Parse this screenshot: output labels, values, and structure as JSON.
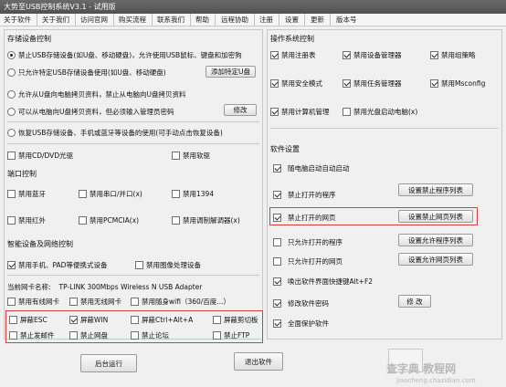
{
  "title": "大势至USB控制系统V3.1 - 试用版",
  "menu": [
    "关于软件",
    "关于我们",
    "访问官网",
    "购买流程",
    "联系我们",
    "帮助",
    "远程协助",
    "注册",
    "设置",
    "更新",
    "版本号"
  ],
  "storage": {
    "title": "存储设备控制",
    "opt1": "禁止USB存储设备(如U盘、移动硬盘)，允许使用USB鼠标、键盘和加密狗",
    "opt2": "只允许特定USB存储设备使用(如U盘、移动硬盘)",
    "add_btn": "添加特定U盘",
    "opt3": "允许从U盘向电脑拷贝资料，禁止从电脑向U盘拷贝资料",
    "opt4": "可以从电脑向U盘拷贝资料，但必须输入管理员密码",
    "modify_btn": "修改",
    "opt5": "恢复USB存储设备、手机或蓝牙等设备的使用(可手动点击恢复设备)",
    "cd": "禁用CD/DVD光驱",
    "floppy": "禁用软驱"
  },
  "ports": {
    "title": "端口控制",
    "bluetooth": "禁用蓝牙",
    "serial": "禁用串口/并口(x)",
    "p1394": "禁用1394",
    "infrared": "禁用红外",
    "pcmcia": "禁用PCMCIA(x)",
    "modem": "禁用调制解调器(x)"
  },
  "smart": {
    "title": "智能设备及网络控制",
    "phone": "禁用手机、PAD等便携式设备",
    "imaging": "禁用图像处理设备",
    "nic_label": "当前网卡名称:",
    "nic_value": "TP-LINK 300Mbps Wireless N USB Adapter",
    "wired": "禁用有线网卡",
    "wireless": "禁用无线网卡",
    "wifi": "禁用随身wifi（360/百度...）"
  },
  "keys": {
    "esc": "屏蔽ESC",
    "win": "屏蔽WIN",
    "ctrl_alt_a": "屏蔽Ctrl+Alt+A",
    "clipboard": "屏蔽剪切板",
    "email": "禁止发邮件",
    "netdisk": "禁止网盘",
    "forum": "禁止论坛",
    "ftp": "禁止FTP"
  },
  "os": {
    "title": "操作系统控制",
    "registry": "禁用注册表",
    "device_mgr": "禁用设备管理器",
    "gpedit": "禁用组策略",
    "safe_mode": "禁用安全模式",
    "task_mgr": "禁用任务管理器",
    "msconfig": "禁用Msconfig",
    "computer_mgmt": "禁用计算机管理",
    "cd_boot": "禁用光盘启动电脑(x)"
  },
  "software": {
    "title": "软件设置",
    "autostart": "随电脑启动自动启动",
    "block_programs": "禁止打开的程序",
    "block_programs_btn": "设置禁止程序列表",
    "block_sites": "禁止打开的网页",
    "block_sites_btn": "设置禁止网页列表",
    "allow_programs": "只允许打开的程序",
    "allow_programs_btn": "设置允许程序列表",
    "allow_sites": "只允许打开的网页",
    "allow_sites_btn": "设置允许网页列表",
    "hotkey": "唤出软件界面快捷键Alt+F2",
    "password": "修改软件密码",
    "password_btn": "修 改",
    "protect": "全面保护软件"
  },
  "footer": {
    "background_btn": "后台运行",
    "exit_btn": "退出软件"
  },
  "watermark": {
    "line1": "查字典 教程网",
    "line2": "jiaocheng.chazidian.com"
  },
  "colors": {
    "highlight": "#d04040",
    "titlebar": "#555555"
  }
}
